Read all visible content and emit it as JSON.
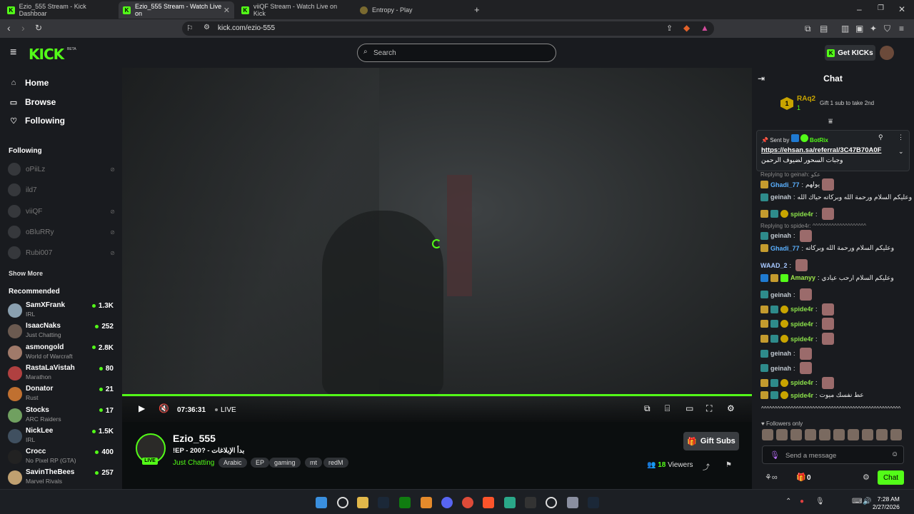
{
  "browser": {
    "tabs": [
      {
        "label": "Ezio_555 Stream - Kick Dashboar",
        "fav": "K",
        "active": false
      },
      {
        "label": "Ezio_555 Stream - Watch Live on",
        "fav": "K",
        "active": true
      },
      {
        "label": "viiQF Stream - Watch Live on Kick",
        "fav": "K",
        "active": false
      },
      {
        "label": "Entropy - Play",
        "fav": "",
        "active": false
      }
    ],
    "url": "kick.com/ezio-555"
  },
  "header": {
    "logo": "KICK",
    "beta": "BETA",
    "search_placeholder": "Search",
    "get_kicks": "Get KICKs"
  },
  "sidebar": {
    "nav": [
      {
        "label": "Home",
        "icon": "home-icon"
      },
      {
        "label": "Browse",
        "icon": "browse-icon"
      },
      {
        "label": "Following",
        "icon": "heart-icon"
      }
    ],
    "following_title": "Following",
    "following": [
      "oPiiLz",
      "ild7",
      "viiQF",
      "oBluRRy",
      "Rubi007"
    ],
    "show_more": "Show More",
    "recommended_title": "Recommended",
    "recommended": [
      {
        "name": "SamXFrank",
        "category": "IRL",
        "viewers": "1.3K",
        "color": "#8aa0b0"
      },
      {
        "name": "IsaacNaks",
        "category": "Just Chatting",
        "viewers": "252",
        "color": "#6b5a50"
      },
      {
        "name": "asmongold",
        "category": "World of Warcraft",
        "viewers": "2.8K",
        "color": "#a07a6a"
      },
      {
        "name": "RastaLaVistah",
        "category": "Marathon",
        "viewers": "80",
        "color": "#b04040"
      },
      {
        "name": "Donator",
        "category": "Rust",
        "viewers": "21",
        "color": "#c07030"
      },
      {
        "name": "Stocks",
        "category": "ARC Raiders",
        "viewers": "17",
        "color": "#70a060"
      },
      {
        "name": "NickLee",
        "category": "IRL",
        "viewers": "1.5K",
        "color": "#405060"
      },
      {
        "name": "Crocc",
        "category": "No Pixel RP (GTA)",
        "viewers": "400",
        "color": "#222222"
      },
      {
        "name": "SavinTheBees",
        "category": "Marvel Rivals",
        "viewers": "257",
        "color": "#c0a070"
      }
    ]
  },
  "player": {
    "time": "07:36:31",
    "live": "LIVE"
  },
  "stream": {
    "channel": "Ezio_555",
    "live_badge": "LIVE",
    "title": "!EP - 200? - بدأ الإبلاغات",
    "category": "Just Chatting",
    "tags": [
      "Arabic",
      "EP",
      "gaming",
      "mt",
      "redM"
    ],
    "gift_subs": "Gift Subs",
    "viewers_count": "18",
    "viewers_label": "Viewers"
  },
  "chat": {
    "title": "Chat",
    "top_gifter": {
      "rank": "1",
      "name": "RAq2",
      "count": "1",
      "note": "Gift 1 sub to take 2nd"
    },
    "pinned": {
      "sent_by_label": "Sent by",
      "sender": "BotRix",
      "link": "https://ehsan.sa/referral/3C47B70A0F",
      "text": "وجبات السحور لضيوف الرحمن"
    },
    "messages": [
      {
        "reply": "Replying to geinah: عكو",
        "user": "Ghadi_77",
        "text": "يولهم",
        "color": "#5ab0ff"
      },
      {
        "user": "geinah",
        "text": "وعليكم السلام ورحمة الله وبركاته حياك الله",
        "color": "#c0c8d0"
      },
      {
        "user": "spide4r",
        "text": "",
        "color": "#8be04a"
      },
      {
        "reply": "Replying to spide4r: ^^^^^^^^^^^^^^^^^^^^",
        "user": "geinah",
        "text": "",
        "color": "#c0c8d0"
      },
      {
        "user": "Ghadi_77",
        "text": "وعليكم السلام ورحمة الله وبركاته",
        "color": "#5ab0ff"
      },
      {
        "user": "WAAD_2",
        "text": "",
        "color": "#a7c8ff"
      },
      {
        "user": "Amanyy",
        "text": "وعليكم السلام ارحب عيادي",
        "color": "#9de84a"
      },
      {
        "user": "geinah",
        "text": "",
        "color": "#c0c8d0"
      },
      {
        "user": "spide4r",
        "text": "",
        "color": "#8be04a"
      },
      {
        "user": "spide4r",
        "text": "",
        "color": "#8be04a"
      },
      {
        "user": "spide4r",
        "text": "",
        "color": "#8be04a"
      },
      {
        "user": "geinah",
        "text": "",
        "color": "#c0c8d0"
      },
      {
        "user": "geinah",
        "text": "",
        "color": "#c0c8d0"
      },
      {
        "user": "spide4r",
        "text": "",
        "color": "#8be04a"
      },
      {
        "user": "spide4r",
        "text": "عط نفسك ميوت",
        "color": "#8be04a"
      }
    ],
    "trail": "^^^^^^^^^^^^^^^^^^^^^^^^^^^^^^^^^^^^^^^^^^^^^^^^^^^^",
    "followers_only": "Followers only",
    "input_placeholder": "Send a message",
    "points": "0",
    "chat_button": "Chat"
  },
  "taskbar": {
    "time": "7:28 AM",
    "date": "2/27/2026"
  },
  "colors": {
    "accent": "#53fc18",
    "bg": "#0b0e0f",
    "panel": "#191b1f"
  }
}
